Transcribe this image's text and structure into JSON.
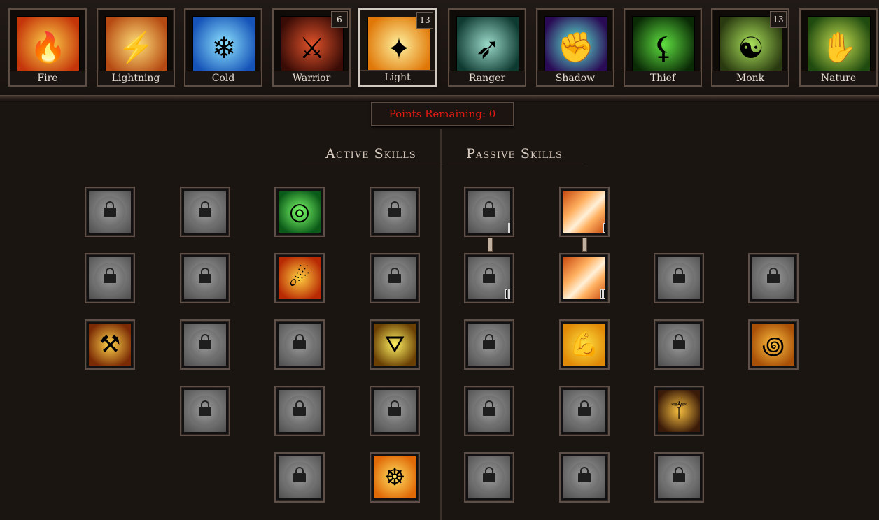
{
  "tree_tabs": [
    {
      "label": "Fire",
      "badge": "",
      "art": "flame-figure",
      "c1": "#ffd24a",
      "c2": "#c4360a"
    },
    {
      "label": "Lightning",
      "badge": "",
      "art": "hammer-lightning",
      "c1": "#ffe07a",
      "c2": "#b64a12"
    },
    {
      "label": "Cold",
      "badge": "",
      "art": "ice-crystal",
      "c1": "#8fe4ff",
      "c2": "#1553b8"
    },
    {
      "label": "Warrior",
      "badge": "6",
      "art": "armored-warrior",
      "c1": "#e0522a",
      "c2": "#3a0c06"
    },
    {
      "label": "Light",
      "badge": "13",
      "art": "light-beam",
      "c1": "#fff2a0",
      "c2": "#e07808"
    },
    {
      "label": "Ranger",
      "badge": "",
      "art": "arrows",
      "c1": "#9ad9c8",
      "c2": "#0f3a32"
    },
    {
      "label": "Shadow",
      "badge": "",
      "art": "shadow-fist",
      "c1": "#5ef0d8",
      "c2": "#2a0a55"
    },
    {
      "label": "Thief",
      "badge": "",
      "art": "poison-blade",
      "c1": "#5fe040",
      "c2": "#0a2a06"
    },
    {
      "label": "Monk",
      "badge": "13",
      "art": "monk-figure",
      "c1": "#a9e05a",
      "c2": "#2a3a10"
    },
    {
      "label": "Nature",
      "badge": "",
      "art": "vine-hand",
      "c1": "#c8e050",
      "c2": "#1f4a10"
    }
  ],
  "points_remaining": "Points Remaining: 0",
  "sections": {
    "active": "Active Skills",
    "passive": "Passive Skills"
  },
  "active_skills": [
    {
      "state": "locked",
      "icon": "lock-icon"
    },
    {
      "state": "locked",
      "icon": "lock-icon"
    },
    {
      "state": "available",
      "icon": "green-vortex",
      "c1": "#7cff6a",
      "c2": "#0b5a18"
    },
    {
      "state": "locked",
      "icon": "lock-icon"
    },
    {
      "state": "locked",
      "icon": "lock-icon"
    },
    {
      "state": "locked",
      "icon": "lock-icon"
    },
    {
      "state": "available",
      "icon": "fire-slash",
      "c1": "#ffd040",
      "c2": "#b82a04"
    },
    {
      "state": "locked",
      "icon": "lock-icon"
    },
    {
      "state": "available",
      "icon": "golden-hammer",
      "c1": "#ffd24a",
      "c2": "#7a2a04"
    },
    {
      "state": "locked",
      "icon": "lock-icon"
    },
    {
      "state": "locked",
      "icon": "lock-icon"
    },
    {
      "state": "available",
      "icon": "holy-sigil",
      "c1": "#fff060",
      "c2": "#6a4004"
    },
    {
      "state": "locked",
      "icon": "lock-icon"
    },
    {
      "state": "locked",
      "icon": "lock-icon"
    },
    {
      "state": "locked",
      "icon": "lock-icon"
    },
    {
      "state": "locked",
      "icon": "lock-icon"
    },
    {
      "state": "available",
      "icon": "meditating-figure",
      "c1": "#ffe060",
      "c2": "#e06a08"
    }
  ],
  "passive_skills": [
    {
      "state": "locked",
      "icon": "lock-icon",
      "rank": 1
    },
    {
      "state": "available",
      "icon": "light-rays",
      "c1": "#ffb060",
      "c2": "#c84a10",
      "rank": 1
    },
    {
      "state": "locked",
      "icon": "lock-icon",
      "rank": 2
    },
    {
      "state": "available",
      "icon": "light-rays",
      "c1": "#ffb060",
      "c2": "#c84a10",
      "rank": 2
    },
    {
      "state": "locked",
      "icon": "lock-icon"
    },
    {
      "state": "locked",
      "icon": "lock-icon"
    },
    {
      "state": "locked",
      "icon": "lock-icon"
    },
    {
      "state": "available",
      "icon": "flexed-arm",
      "c1": "#ffe040",
      "c2": "#e08a08"
    },
    {
      "state": "locked",
      "icon": "lock-icon"
    },
    {
      "state": "available",
      "icon": "golden-spiral",
      "c1": "#ffc040",
      "c2": "#a85008"
    },
    {
      "state": "locked",
      "icon": "lock-icon"
    },
    {
      "state": "locked",
      "icon": "lock-icon"
    },
    {
      "state": "available",
      "icon": "ruby-scepter",
      "c1": "#f8c040",
      "c2": "#3a1a08"
    },
    {
      "state": "locked",
      "icon": "lock-icon"
    },
    {
      "state": "locked",
      "icon": "lock-icon"
    },
    {
      "state": "locked",
      "icon": "lock-icon"
    }
  ]
}
